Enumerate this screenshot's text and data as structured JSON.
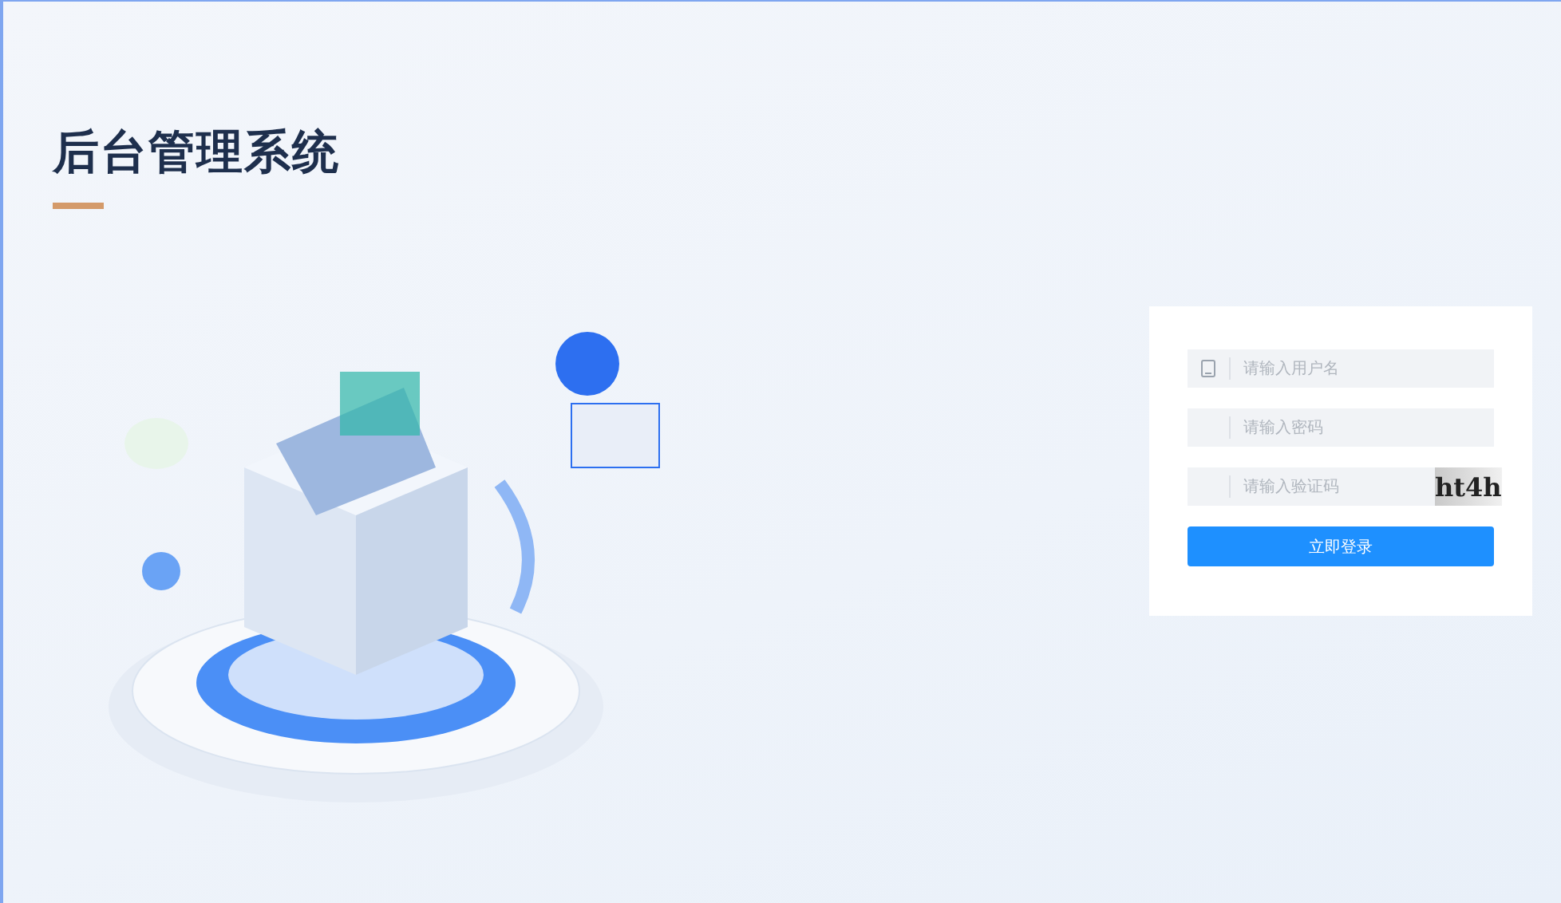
{
  "title": "后台管理系统",
  "login": {
    "fields": [
      {
        "kind": "username",
        "placeholder": "请输入用户名"
      },
      {
        "kind": "password",
        "placeholder": "请输入密码"
      },
      {
        "kind": "captcha",
        "placeholder": "请输入验证码",
        "captcha": "ht4h"
      }
    ],
    "button": "立即登录"
  }
}
